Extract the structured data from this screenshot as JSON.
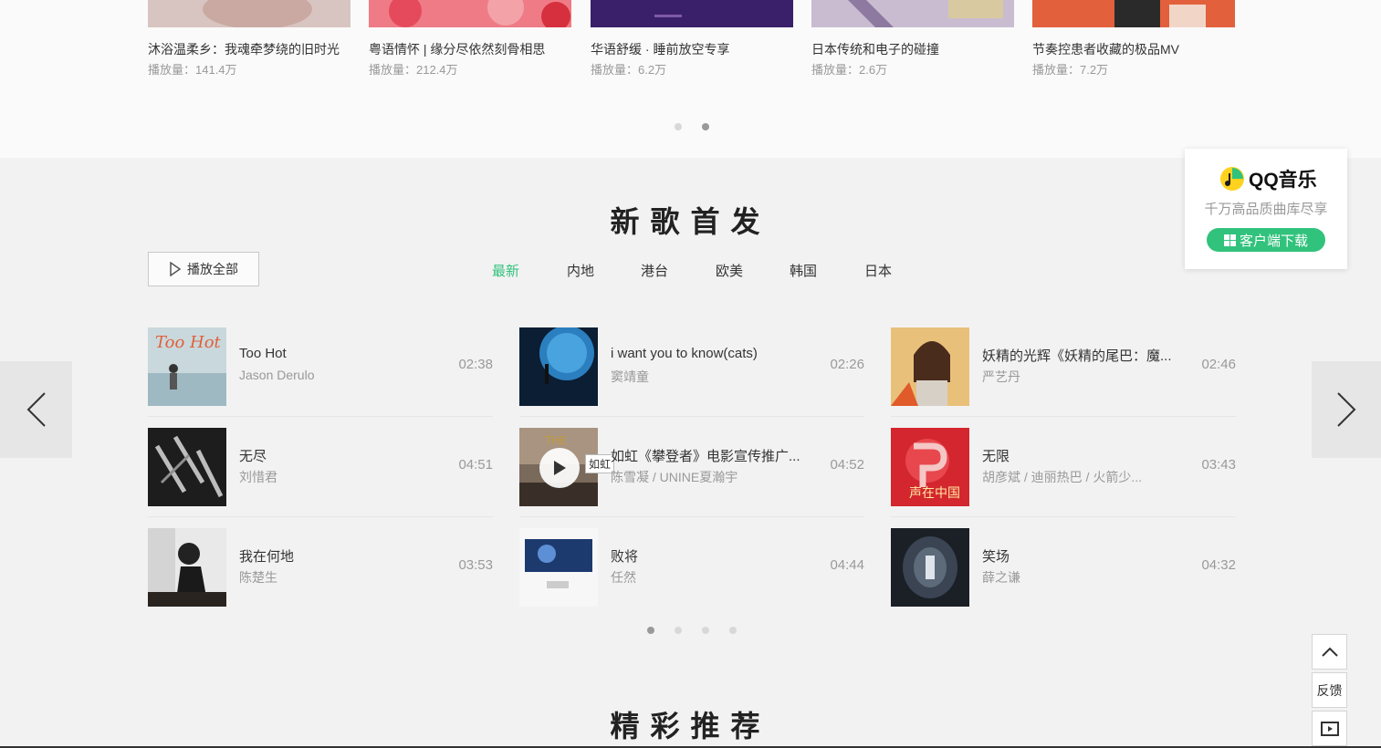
{
  "playlists": [
    {
      "title": "沐浴温柔乡：我魂牵梦绕的旧时光",
      "plays": "播放量：141.4万"
    },
    {
      "title": "粤语情怀 | 缘分尽依然刻骨相思",
      "plays": "播放量：212.4万"
    },
    {
      "title": "华语舒缓 · 睡前放空专享",
      "plays": "播放量：6.2万"
    },
    {
      "title": "日本传统和电子的碰撞",
      "plays": "播放量：2.6万"
    },
    {
      "title": "节奏控患者收藏的极品MV",
      "plays": "播放量：7.2万"
    }
  ],
  "new_songs": {
    "title": "新歌首发",
    "play_all": "播放全部",
    "tabs": [
      "最新",
      "内地",
      "港台",
      "欧美",
      "韩国",
      "日本"
    ],
    "active_tab": "最新",
    "songs": [
      {
        "name": "Too Hot",
        "artist": "Jason Derulo",
        "duration": "02:38"
      },
      {
        "name": "i want you to know(cats)",
        "artist": "窦靖童",
        "duration": "02:26"
      },
      {
        "name": "妖精的光辉《妖精的尾巴：魔...",
        "artist": "严艺丹",
        "duration": "02:46"
      },
      {
        "name": "无尽",
        "artist": "刘惜君",
        "duration": "04:51"
      },
      {
        "name": "如虹《攀登者》电影宣传推广...",
        "artist": "陈雪凝 / UNINE夏瀚宇",
        "duration": "04:52"
      },
      {
        "name": "无限",
        "artist": "胡彦斌 / 迪丽热巴 / 火箭少...",
        "duration": "03:43"
      },
      {
        "name": "我在何地",
        "artist": "陈楚生",
        "duration": "03:53"
      },
      {
        "name": "败将",
        "artist": "任然",
        "duration": "04:44"
      },
      {
        "name": "笑场",
        "artist": "薛之谦",
        "duration": "04:32"
      }
    ],
    "hover_tip": "如虹"
  },
  "recommend": {
    "title": "精彩推荐"
  },
  "promo": {
    "brand": "QQ音乐",
    "subtitle": "千万高品质曲库尽享",
    "button": "客户端下载"
  },
  "side_tools": {
    "feedback": "反馈"
  },
  "icons": [
    "play-outline-icon",
    "chevron-left-icon",
    "chevron-right-icon",
    "play-icon",
    "qq-music-logo-icon",
    "windows-icon",
    "arrow-up-icon",
    "video-icon"
  ],
  "colors": {
    "accent": "#31c27c",
    "text": "#333333",
    "muted": "#999999",
    "section_bg": "#f2f2f2"
  }
}
